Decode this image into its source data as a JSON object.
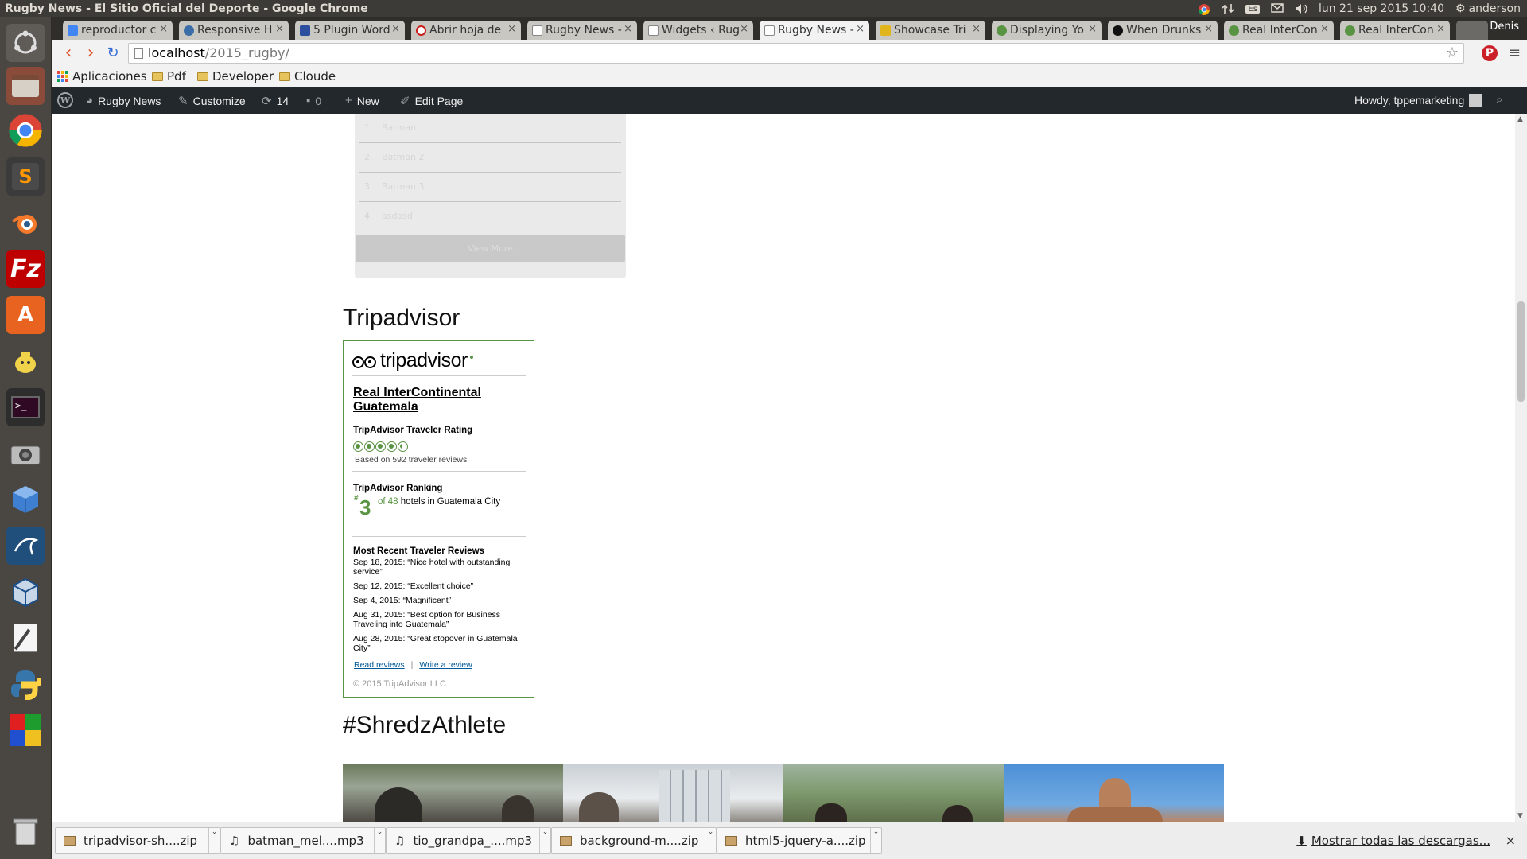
{
  "window": {
    "title": "Rugby News - El Sitio Oficial del Deporte - Google Chrome",
    "datetime": "lun 21 sep 2015 10:40",
    "user": "anderson",
    "keyboard": "Es"
  },
  "launcher": {
    "icons": [
      "ubuntu-dash-icon",
      "files-icon",
      "chrome-icon",
      "sublime-icon",
      "blender-icon",
      "filezilla-icon",
      "software-center-icon",
      "teapot-icon",
      "terminal-icon",
      "camera-icon",
      "cube-icon",
      "mysql-workbench-icon",
      "virtualbox-icon",
      "text-editor-icon",
      "python-icon",
      "color-squares-icon",
      "trash-icon"
    ]
  },
  "browser": {
    "profile": "Denis",
    "tabs": [
      {
        "label": "reproductor c",
        "color": "#4285f4"
      },
      {
        "label": "Responsive H",
        "color": "#3b6ea8"
      },
      {
        "label": "5 Plugin Word",
        "color": "#2b4f9e"
      },
      {
        "label": "Abrir hoja de",
        "color": "#cc1d1d"
      },
      {
        "label": "Rugby News -",
        "color": "#ffffff"
      },
      {
        "label": "Widgets ‹ Rug",
        "color": "#ffffff"
      },
      {
        "label": "Rugby News -",
        "color": "#ffffff",
        "active": true
      },
      {
        "label": "Showcase Tri",
        "color": "#e2b61b"
      },
      {
        "label": "Displaying Yo",
        "color": "#589442"
      },
      {
        "label": "When Drunks",
        "color": "#111111"
      },
      {
        "label": "Real InterCon",
        "color": "#589442"
      },
      {
        "label": "Real InterCon",
        "color": "#589442"
      }
    ],
    "url_host": "localhost",
    "url_path": "/2015_rugby/",
    "bookmarks": [
      "Aplicaciones",
      "Pdf",
      "Developer",
      "Cloude"
    ]
  },
  "wp_admin_bar": {
    "site_name": "Rugby News",
    "customize": "Customize",
    "updates_count": "14",
    "comments_count": "0",
    "new_label": "New",
    "edit_page": "Edit Page",
    "howdy": "Howdy, tppemarketing"
  },
  "faded_widget": {
    "rows": [
      {
        "num": "1.",
        "text": "Batman"
      },
      {
        "num": "2.",
        "text": "Batman 2"
      },
      {
        "num": "3.",
        "text": "Batman 3"
      },
      {
        "num": "4.",
        "text": "asdasd"
      }
    ],
    "button": "View More"
  },
  "tripadvisor_section": {
    "title": "Tripadvisor",
    "logo_text": "tripadvisor",
    "hotel": "Real InterContinental Guatemala",
    "rating_heading": "TripAdvisor Traveler Rating",
    "rating": 4.5,
    "rating_max": 5,
    "based_on": "Based on 592 traveler reviews",
    "ranking_heading": "TripAdvisor Ranking",
    "rank_prefix": "#",
    "rank": "3",
    "rank_of": "of 48",
    "rank_rest": "hotels in Guatemala City",
    "reviews_heading": "Most Recent Traveler Reviews",
    "reviews": [
      "Sep 18, 2015: “Nice hotel with outstanding service”",
      "Sep 12, 2015: “Excellent choice”",
      "Sep 4, 2015: “Magnificent”",
      "Aug 31, 2015: “Best option for Business Traveling into Guatemala”",
      "Aug 28, 2015: “Great stopover in Guatemala City”"
    ],
    "read_reviews": "Read reviews",
    "write_review": "Write a review",
    "copyright": "© 2015 TripAdvisor LLC"
  },
  "shredz_section": {
    "title": "#ShredzAthlete"
  },
  "downloads": {
    "items": [
      {
        "name": "tripadvisor-sh....zip",
        "type": "zip"
      },
      {
        "name": "batman_mel....mp3",
        "type": "mp3"
      },
      {
        "name": "tio_grandpa_....mp3",
        "type": "mp3"
      },
      {
        "name": "background-m....zip",
        "type": "zip"
      },
      {
        "name": "html5-jquery-a....zip",
        "type": "zip"
      }
    ],
    "show_all": "Mostrar todas las descargas..."
  },
  "colors": {
    "tripadvisor_green": "#589442",
    "wp_bar": "#23282d",
    "launcher": "#4a4743",
    "accent_orange": "#e0532c"
  }
}
